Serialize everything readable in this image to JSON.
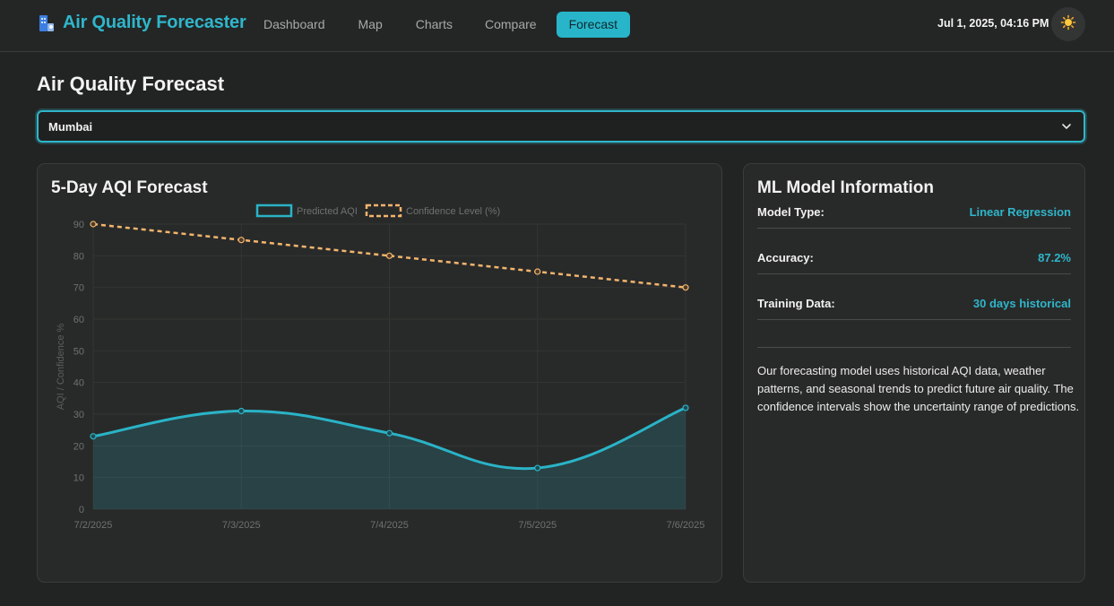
{
  "header": {
    "app_title": "Air Quality Forecaster",
    "nav": [
      {
        "label": "Dashboard",
        "active": false
      },
      {
        "label": "Map",
        "active": false
      },
      {
        "label": "Charts",
        "active": false
      },
      {
        "label": "Compare",
        "active": false
      },
      {
        "label": "Forecast",
        "active": true
      }
    ],
    "datetime": "Jul 1, 2025, 04:16 PM",
    "theme_icon": "sun-icon",
    "brand_icon": "building-icon"
  },
  "page": {
    "title": "Air Quality Forecast",
    "city_select": {
      "value": "Mumbai"
    }
  },
  "forecast_card": {
    "title": "5-Day AQI Forecast"
  },
  "chart_data": {
    "type": "line",
    "x": [
      "7/2/2025",
      "7/3/2025",
      "7/4/2025",
      "7/5/2025",
      "7/6/2025"
    ],
    "ylim": [
      0,
      90
    ],
    "yticks": [
      0,
      10,
      20,
      30,
      40,
      50,
      60,
      70,
      80,
      90
    ],
    "ylabel": "AQI / Confidence %",
    "xlabel": "",
    "legend_position": "top",
    "grid": true,
    "series": [
      {
        "name": "Predicted AQI",
        "values": [
          23,
          31,
          24,
          13,
          32
        ],
        "color": "#2ab3c7",
        "style": "solid",
        "fill": true
      },
      {
        "name": "Confidence Level (%)",
        "values": [
          90,
          85,
          80,
          75,
          70
        ],
        "color": "#f5b46e",
        "style": "dashed",
        "fill": false
      }
    ]
  },
  "model_card": {
    "title": "ML Model Information",
    "rows": [
      {
        "label": "Model Type:",
        "value": "Linear Regression"
      },
      {
        "label": "Accuracy:",
        "value": "87.2%"
      },
      {
        "label": "Training Data:",
        "value": "30 days historical"
      }
    ],
    "description": "Our forecasting model uses historical AQI data, weather patterns, and seasonal trends to predict future air quality. The confidence intervals show the uncertainty range of predictions."
  },
  "colors": {
    "accent": "#2fb6cb",
    "background": "#222423",
    "card": "#282a29",
    "confidence": "#f5b46e"
  }
}
